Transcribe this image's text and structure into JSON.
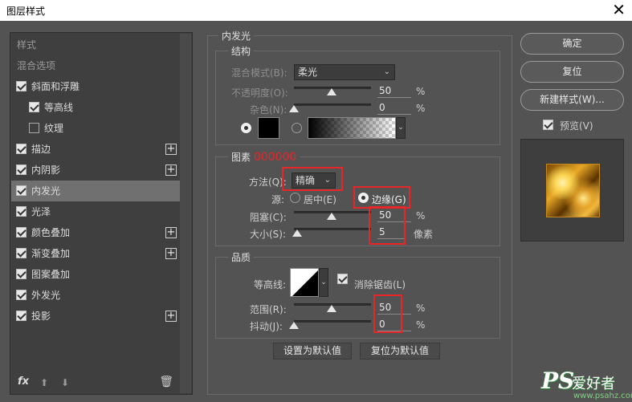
{
  "window": {
    "title": "图层样式",
    "close": "✕"
  },
  "sidebar": {
    "header_styles": "样式",
    "header_blend": "混合选项",
    "items": [
      {
        "label": "斜面和浮雕",
        "checked": true
      },
      {
        "label": "等高线",
        "checked": true
      },
      {
        "label": "纹理",
        "checked": false
      },
      {
        "label": "描边",
        "checked": true
      },
      {
        "label": "内阴影",
        "checked": true
      },
      {
        "label": "内发光",
        "checked": true
      },
      {
        "label": "光泽",
        "checked": true
      },
      {
        "label": "颜色叠加",
        "checked": true
      },
      {
        "label": "渐变叠加",
        "checked": true
      },
      {
        "label": "图案叠加",
        "checked": true
      },
      {
        "label": "外发光",
        "checked": true
      },
      {
        "label": "投影",
        "checked": true
      }
    ],
    "plus": "+",
    "fx": "fx",
    "up": "⬆",
    "down": "⬇",
    "trash": "🗑"
  },
  "panel": {
    "title": "内发光",
    "structure": {
      "title": "结构",
      "blend_label": "混合模式(B):",
      "blend_value": "柔光",
      "opacity_label": "不透明度(O):",
      "opacity_value": "50",
      "opacity_unit": "%",
      "noise_label": "杂色(N):",
      "noise_value": "0",
      "noise_unit": "%"
    },
    "elements": {
      "title": "图素",
      "annotation": "000000",
      "method_label": "方法(Q):",
      "method_value": "精确",
      "source_label": "源:",
      "center_label": "居中(E)",
      "edge_label": "边缘(G)",
      "choke_label": "阻塞(C):",
      "choke_value": "50",
      "choke_unit": "%",
      "size_label": "大小(S):",
      "size_value": "5",
      "size_unit": "像素"
    },
    "quality": {
      "title": "品质",
      "contour_label": "等高线:",
      "antialias_label": "消除锯齿(L)",
      "range_label": "范围(R):",
      "range_value": "50",
      "range_unit": "%",
      "jitter_label": "抖动(J):",
      "jitter_value": "0",
      "jitter_unit": "%"
    },
    "set_default": "设置为默认值",
    "reset_default": "复位为默认值",
    "chev": "⌄"
  },
  "side": {
    "ok": "确定",
    "reset": "复位",
    "new_style": "新建样式(W)...",
    "preview": "预览(V)"
  },
  "watermark": {
    "logo": "PS",
    "text": "爱好者",
    "url": "www.psahz.com"
  },
  "colors": {
    "annotation": "#e8262a",
    "accent_red": "#e8262a"
  }
}
